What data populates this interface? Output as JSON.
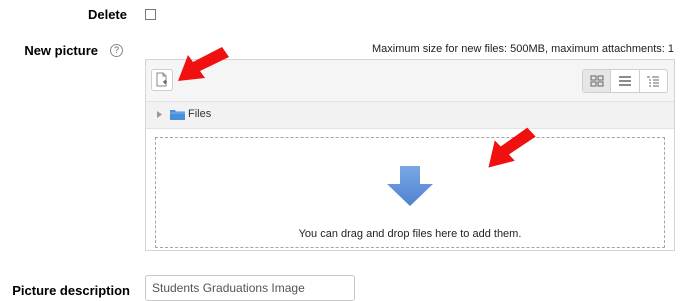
{
  "form": {
    "delete_label": "Delete",
    "delete_checked": false,
    "new_picture_label": "New picture",
    "help_glyph": "?",
    "picture_description_label": "Picture description",
    "picture_description_value": "Students Graduations Image"
  },
  "filepicker": {
    "max_size_text": "Maximum size for new files: 500MB, maximum attachments: 1",
    "path_label": "Files",
    "dropzone_text": "You can drag and drop files here to add them.",
    "view_modes": [
      "icons-view",
      "list-view",
      "tree-view"
    ],
    "active_view": "icons-view"
  },
  "colors": {
    "annotation_arrow": "#f01010",
    "dropzone_arrow": "#5b8fd6",
    "folder": "#4a90d9"
  }
}
